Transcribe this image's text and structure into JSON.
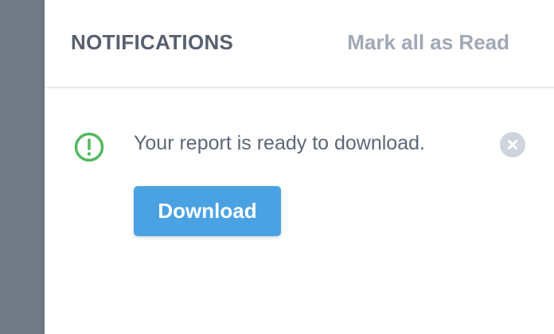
{
  "panel": {
    "title": "NOTIFICATIONS",
    "mark_all_label": "Mark all as Read"
  },
  "notification": {
    "icon": "alert-circle-icon",
    "message": "Your report is ready to download.",
    "action_label": "Download",
    "close_icon": "close-circle-icon"
  },
  "colors": {
    "overlay": "#707986",
    "title": "#58606e",
    "muted_link": "#a1a8b6",
    "alert_green": "#52b85f",
    "message_text": "#5d6676",
    "close_bg": "#cfd4dd",
    "button_blue": "#4ba2e3"
  }
}
